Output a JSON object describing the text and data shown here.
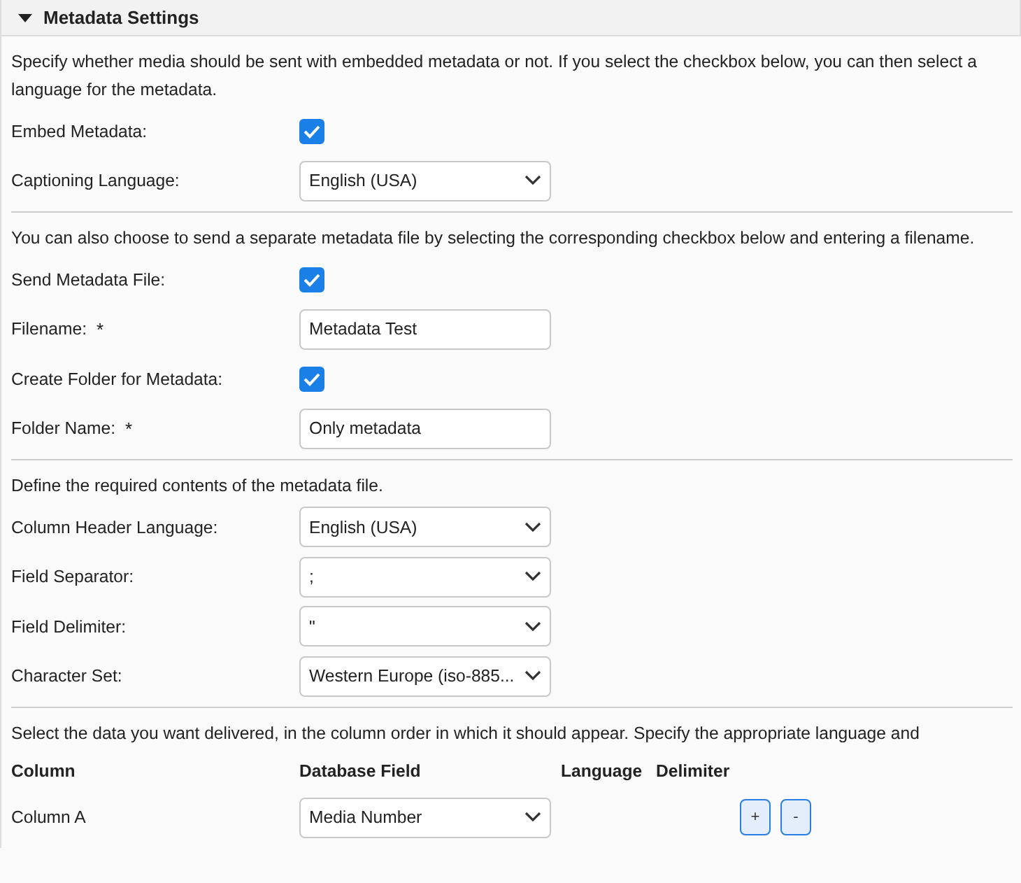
{
  "panel": {
    "title": "Metadata Settings",
    "expanded": true
  },
  "sections": [
    {
      "intro": "Specify whether media should be sent with embedded metadata or not. If you select the checkbox below, you can then select a language for the metadata.",
      "rows": [
        {
          "kind": "checkbox",
          "label": "Embed Metadata:",
          "checked": true
        },
        {
          "kind": "select",
          "label": "Captioning Language:",
          "value": "English (USA)"
        }
      ]
    },
    {
      "intro": "You can also choose to send a separate metadata file by selecting the corresponding checkbox below and entering a filename.",
      "rows": [
        {
          "kind": "checkbox",
          "label": "Send Metadata File:",
          "checked": true
        },
        {
          "kind": "text",
          "label": "Filename:",
          "required_mark": "*",
          "value": "Metadata Test"
        },
        {
          "kind": "checkbox",
          "label": "Create Folder for Metadata:",
          "checked": true
        },
        {
          "kind": "text",
          "label": "Folder Name:",
          "required_mark": "*",
          "value": "Only metadata"
        }
      ]
    },
    {
      "intro": "Define the required contents of the metadata file.",
      "rows": [
        {
          "kind": "select",
          "label": "Column Header Language:",
          "value": "English (USA)"
        },
        {
          "kind": "select",
          "label": "Field Separator:",
          "value": ";"
        },
        {
          "kind": "select",
          "label": "Field Delimiter:",
          "value": "\""
        },
        {
          "kind": "select",
          "label": "Character Set:",
          "value": "Western Europe (iso-885..."
        }
      ]
    }
  ],
  "columns_section": {
    "intro": "Select the data you want delivered, in the column order in which it should appear. Specify the appropriate language and",
    "columns": [
      "Column",
      "Database Field",
      "Language",
      "Delimiter"
    ],
    "rows": [
      {
        "column": "Column A",
        "field": "Media Number",
        "buttons": [
          "+",
          "-"
        ]
      }
    ]
  }
}
